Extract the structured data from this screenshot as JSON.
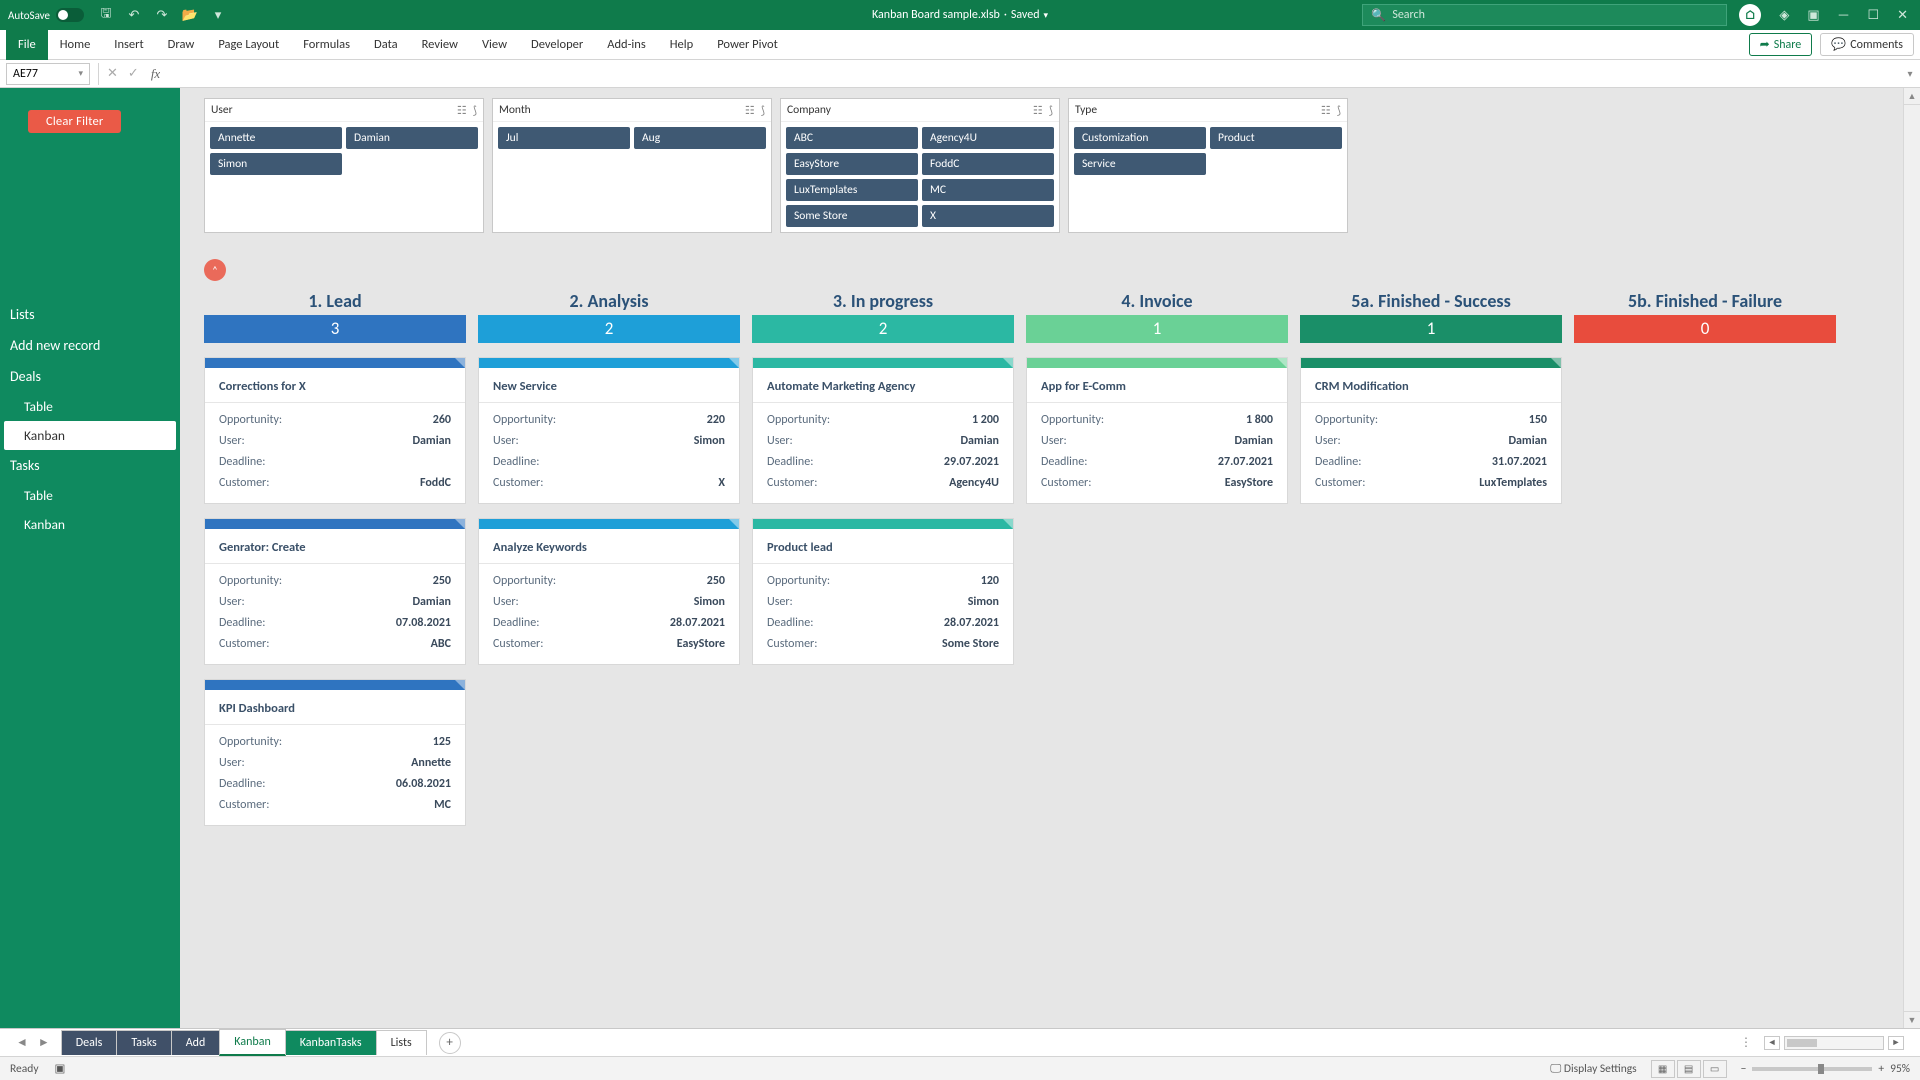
{
  "title": {
    "autosave": "AutoSave",
    "file": "Kanban Board sample.xlsb",
    "state": "Saved",
    "search": "Search"
  },
  "ribbon": {
    "tabs": [
      "File",
      "Home",
      "Insert",
      "Draw",
      "Page Layout",
      "Formulas",
      "Data",
      "Review",
      "View",
      "Developer",
      "Add-ins",
      "Help",
      "Power Pivot"
    ],
    "share": "Share",
    "comments": "Comments"
  },
  "fbar": {
    "name": "AE77"
  },
  "nav": {
    "clear": "Clear Filter",
    "items": [
      "Lists",
      "Add new record",
      "Deals",
      "Table",
      "Kanban",
      "Tasks",
      "Table",
      "Kanban"
    ]
  },
  "slicers": [
    {
      "title": "User",
      "chips": [
        "Annette",
        "Damian",
        "Simon"
      ]
    },
    {
      "title": "Month",
      "chips": [
        "Jul",
        "Aug"
      ]
    },
    {
      "title": "Company",
      "chips": [
        "ABC",
        "Agency4U",
        "EasyStore",
        "FoddC",
        "LuxTemplates",
        "MC",
        "Some Store",
        "X"
      ]
    },
    {
      "title": "Type",
      "chips": [
        "Customization",
        "Product",
        "Service"
      ]
    }
  ],
  "columns": [
    {
      "title": "1. Lead",
      "count": "3"
    },
    {
      "title": "2. Analysis",
      "count": "2"
    },
    {
      "title": "3. In progress",
      "count": "2"
    },
    {
      "title": "4. Invoice",
      "count": "1"
    },
    {
      "title": "5a. Finished - Success",
      "count": "1"
    },
    {
      "title": "5b. Finished - Failure",
      "count": "0"
    }
  ],
  "labels": {
    "opp": "Opportunity:",
    "user": "User:",
    "dead": "Deadline:",
    "cust": "Customer:"
  },
  "cards": {
    "c1": [
      {
        "t": "Corrections for X",
        "o": "260",
        "u": "Damian",
        "d": "",
        "c": "FoddC"
      },
      {
        "t": "Genrator: Create",
        "o": "250",
        "u": "Damian",
        "d": "07.08.2021",
        "c": "ABC"
      },
      {
        "t": "KPI Dashboard",
        "o": "125",
        "u": "Annette",
        "d": "06.08.2021",
        "c": "MC"
      }
    ],
    "c2": [
      {
        "t": "New Service",
        "o": "220",
        "u": "Simon",
        "d": "",
        "c": "X"
      },
      {
        "t": "Analyze Keywords",
        "o": "250",
        "u": "Simon",
        "d": "28.07.2021",
        "c": "EasyStore"
      }
    ],
    "c3": [
      {
        "t": "Automate Marketing Agency",
        "o": "1 200",
        "u": "Damian",
        "d": "29.07.2021",
        "c": "Agency4U"
      },
      {
        "t": "Product lead",
        "o": "120",
        "u": "Simon",
        "d": "28.07.2021",
        "c": "Some Store"
      }
    ],
    "c4": [
      {
        "t": "App for E-Comm",
        "o": "1 800",
        "u": "Damian",
        "d": "27.07.2021",
        "c": "EasyStore"
      }
    ],
    "c5": [
      {
        "t": "CRM Modification",
        "o": "150",
        "u": "Damian",
        "d": "31.07.2021",
        "c": "LuxTemplates"
      }
    ]
  },
  "sheets": [
    "Deals",
    "Tasks",
    "Add",
    "Kanban",
    "KanbanTasks",
    "Lists"
  ],
  "status": {
    "ready": "Ready",
    "display": "Display Settings",
    "zoom": "95%"
  }
}
